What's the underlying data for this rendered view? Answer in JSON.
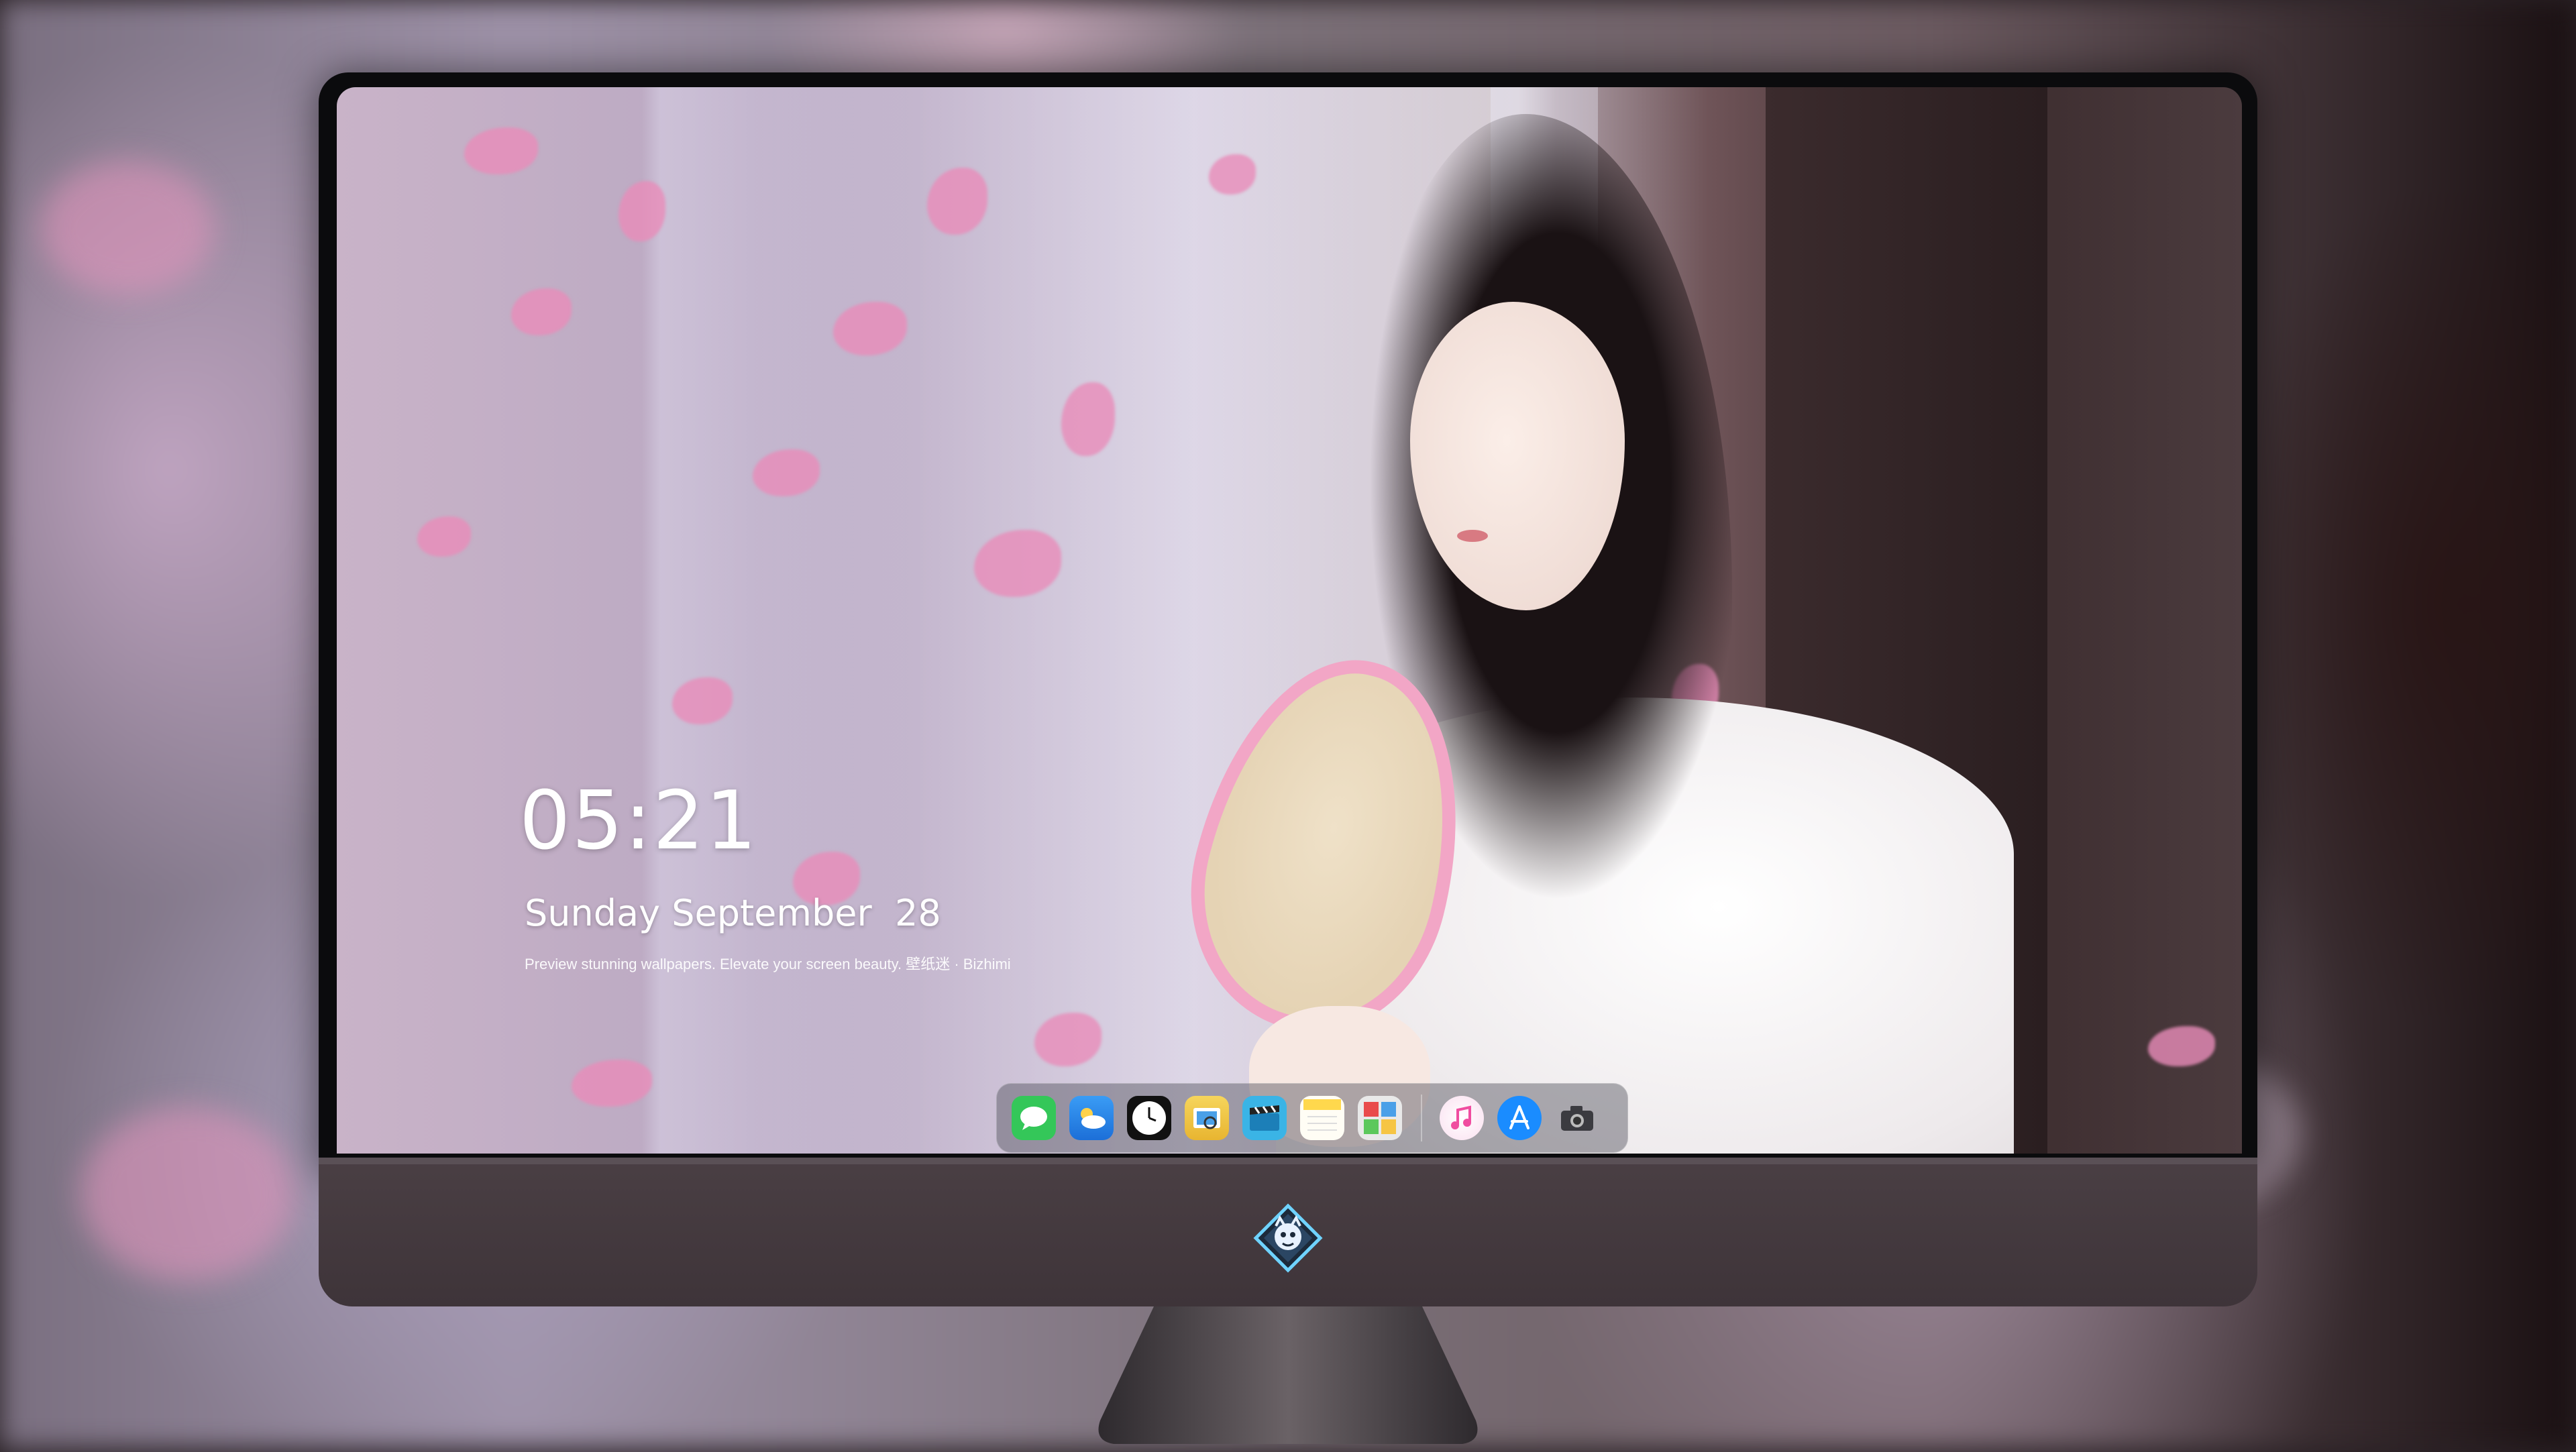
{
  "lock_screen": {
    "time": "05:21",
    "date": "Sunday September  28",
    "tagline": "Preview stunning wallpapers. Elevate your screen beauty. 壁纸迷 · Bizhimi"
  },
  "dock": {
    "apps": [
      {
        "name": "messages-icon",
        "color": "#34c759"
      },
      {
        "name": "weather-icon",
        "color": "#2f8cf0"
      },
      {
        "name": "clock-icon",
        "color": "#111111"
      },
      {
        "name": "preview-icon",
        "color": "#f4c542"
      },
      {
        "name": "clips-icon",
        "color": "#3ab4e6"
      },
      {
        "name": "notes-icon",
        "color": "#ffd84d"
      },
      {
        "name": "photo-booth-icon",
        "color": "#e6e6e6"
      }
    ],
    "apps_right": [
      {
        "name": "music-icon",
        "color": "#f04da0"
      },
      {
        "name": "app-store-icon",
        "color": "#1a8cff"
      },
      {
        "name": "camera-icon",
        "color": "#6a6a70"
      }
    ]
  },
  "monitor": {
    "logo": "dragon-badge-icon"
  }
}
